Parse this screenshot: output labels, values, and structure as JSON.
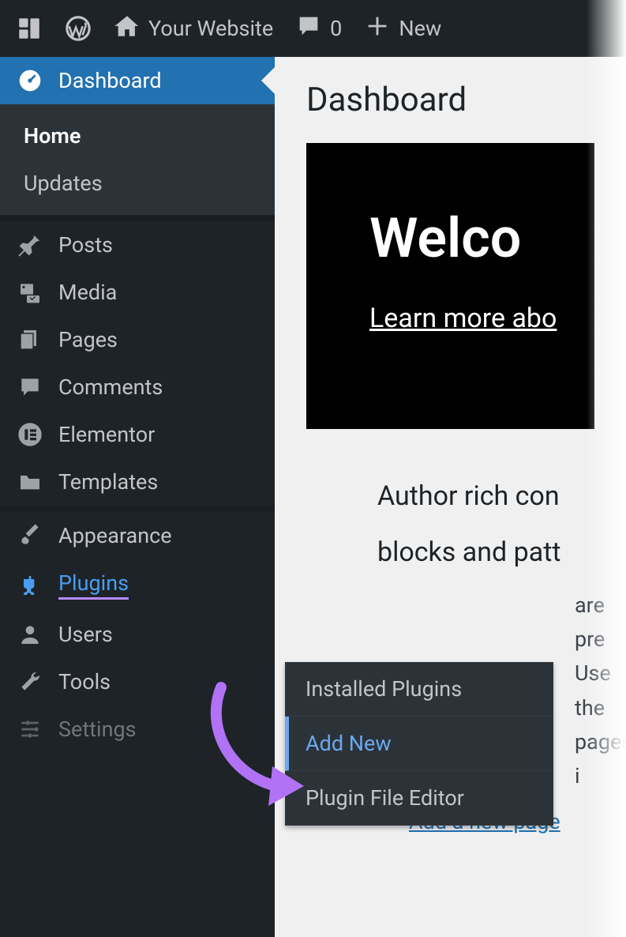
{
  "adminbar": {
    "site_name": "Your Website",
    "comments_count": "0",
    "new_label": "New"
  },
  "sidebar": {
    "dashboard": {
      "label": "Dashboard"
    },
    "submenu_dashboard": {
      "home": "Home",
      "updates": "Updates"
    },
    "items": [
      {
        "label": "Posts"
      },
      {
        "label": "Media"
      },
      {
        "label": "Pages"
      },
      {
        "label": "Comments"
      },
      {
        "label": "Elementor"
      },
      {
        "label": "Templates"
      },
      {
        "label": "Appearance"
      },
      {
        "label": "Plugins"
      },
      {
        "label": "Users"
      },
      {
        "label": "Tools"
      },
      {
        "label": "Settings"
      }
    ]
  },
  "plugins_flyout": {
    "installed": "Installed Plugins",
    "add_new": "Add New",
    "editor": "Plugin File Editor"
  },
  "main": {
    "page_title": "Dashboard",
    "welcome_title": "Welco",
    "welcome_link": "Learn more abo",
    "body_heading_1": "Author rich con",
    "body_heading_2": "blocks and patt",
    "body_text_1": "are pre",
    "body_text_2": "Use the",
    "body_text_3": "pages i",
    "body_link": "Add a new page"
  }
}
